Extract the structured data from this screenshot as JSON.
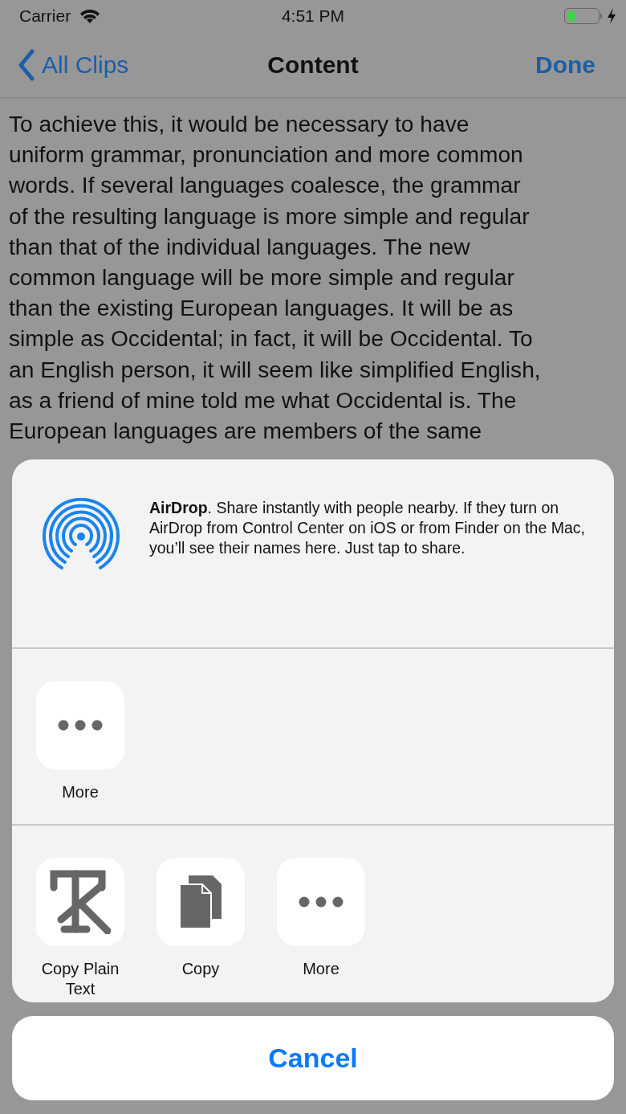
{
  "status_bar": {
    "carrier": "Carrier",
    "time": "4:51 PM",
    "charging": true,
    "battery": {
      "level": 0.3
    }
  },
  "nav_bar": {
    "back": "All Clips",
    "title": "Content",
    "action": "Done"
  },
  "content": {
    "lines": [
      "To achieve this, it would be necessary to have",
      "uniform grammar, pronunciation and more common",
      "words. If several languages coalesce, the grammar",
      "of the resulting language is more simple and regular",
      "than that of the individual languages. The new",
      "common language will be more simple and regular",
      "than the existing European languages. It will be as",
      "simple as Occidental; in fact, it will be Occidental. To",
      "an English person, it will seem like simplified English,",
      "as a friend of mine told me what Occidental is. The",
      "European languages are members of the same"
    ]
  },
  "share_sheet": {
    "airdrop": "**AirDrop**. Share instantly with people nearby. If they turn on AirDrop from Control Center on iOS or from Finder on the Mac, you’ll see their names here. Just tap to share.",
    "share_row": [
      {
        "kind": "more",
        "label": "More"
      }
    ],
    "action_row": [
      {
        "kind": "plain-text",
        "label": "Copy Plain Text"
      },
      {
        "kind": "copy",
        "label": "Copy"
      },
      {
        "kind": "more",
        "label": "More"
      }
    ]
  },
  "cancel": "Cancel"
}
